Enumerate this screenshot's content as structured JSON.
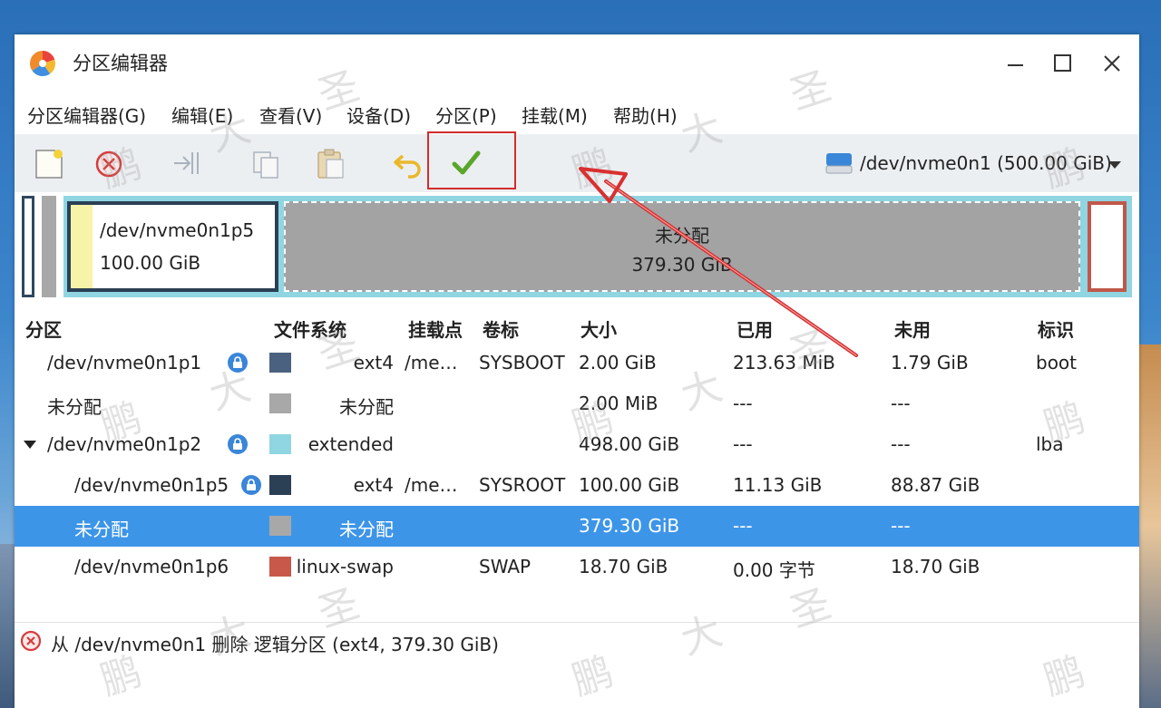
{
  "window": {
    "title": "分区编辑器"
  },
  "menu": {
    "items": [
      "分区编辑器(G)",
      "编辑(E)",
      "查看(V)",
      "设备(D)",
      "分区(P)",
      "挂载(M)",
      "帮助(H)"
    ]
  },
  "toolbar": {
    "buttons": [
      "new-icon",
      "delete-icon",
      "resize-icon",
      "copy-icon",
      "paste-icon",
      "undo-icon",
      "apply-icon"
    ],
    "device": "/dev/nvme0n1 (500.00 GiB)"
  },
  "diskmap": {
    "p5_name": "/dev/nvme0n1p5",
    "p5_size": "100.00 GiB",
    "unalloc_name": "未分配",
    "unalloc_size": "379.30 GiB"
  },
  "table": {
    "headers": [
      "分区",
      "文件系统",
      "挂载点",
      "卷标",
      "大小",
      "已用",
      "未用",
      "标识"
    ],
    "rows": [
      {
        "partition": "/dev/nvme0n1p1",
        "fs": "ext4",
        "fs_color": "#4a6280",
        "mount": "/me…",
        "label": "SYSBOOT",
        "size": "2.00 GiB",
        "used": "213.63 MiB",
        "unused": "1.79 GiB",
        "flags": "boot",
        "locked": true
      },
      {
        "partition": "未分配",
        "fs": "未分配",
        "fs_color": "#a8a8a8",
        "mount": "",
        "label": "",
        "size": "2.00 MiB",
        "used": "---",
        "unused": "---",
        "flags": "",
        "locked": false
      },
      {
        "partition": "/dev/nvme0n1p2",
        "fs": "extended",
        "fs_color": "#8fd6e2",
        "mount": "",
        "label": "",
        "size": "498.00 GiB",
        "used": "---",
        "unused": "---",
        "flags": "lba",
        "locked": true
      },
      {
        "partition": "/dev/nvme0n1p5",
        "fs": "ext4",
        "fs_color": "#2b3f55",
        "mount": "/me…",
        "label": "SYSROOT",
        "size": "100.00 GiB",
        "used": "11.13 GiB",
        "unused": "88.87 GiB",
        "flags": "",
        "locked": true
      },
      {
        "partition": "未分配",
        "fs": "未分配",
        "fs_color": "#a8a8a8",
        "mount": "",
        "label": "",
        "size": "379.30 GiB",
        "used": "---",
        "unused": "---",
        "flags": "",
        "locked": false
      },
      {
        "partition": "/dev/nvme0n1p6",
        "fs": "linux-swap",
        "fs_color": "#c8584a",
        "mount": "",
        "label": "SWAP",
        "size": "18.70 GiB",
        "used": "0.00 字节",
        "unused": "18.70 GiB",
        "flags": "",
        "locked": false
      }
    ]
  },
  "status": {
    "text": "从 /dev/nvme0n1 删除 逻辑分区 (ext4, 379.30 GiB)"
  },
  "colors": {
    "accent": "#3d95e8",
    "highlight": "#d22c2c",
    "arrow": "#d93030"
  },
  "watermark": {
    "chars": [
      "大",
      "圣",
      "鹏"
    ]
  }
}
